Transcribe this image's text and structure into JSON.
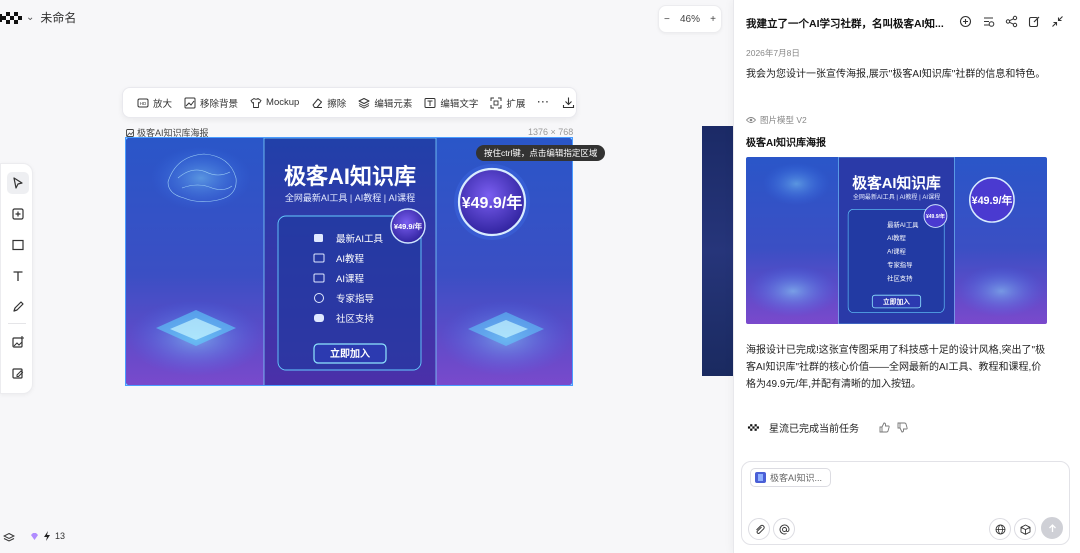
{
  "app": {
    "doc_title": "未命名"
  },
  "zoom": {
    "minus": "−",
    "value": "46%",
    "plus": "+"
  },
  "left_toolbar": {
    "tools": [
      "select-icon",
      "add-frame-icon",
      "rectangle-icon",
      "text-icon",
      "pen-icon",
      "image-add-icon",
      "image-edit-icon"
    ]
  },
  "image_toolbar": {
    "items": [
      {
        "icon": "hd-icon",
        "label": "放大"
      },
      {
        "icon": "remove-bg-icon",
        "label": "移除背景"
      },
      {
        "icon": "shirt-icon",
        "label": "Mockup"
      },
      {
        "icon": "eraser-icon",
        "label": "擦除"
      },
      {
        "icon": "layers-edit-icon",
        "label": "编辑元素"
      },
      {
        "icon": "text-edit-icon",
        "label": "编辑文字"
      },
      {
        "icon": "expand-icon",
        "label": "扩展"
      }
    ],
    "more": "···"
  },
  "canvas": {
    "label": "极客AI知识库海报",
    "size": "1376 × 768",
    "tooltip": "按住ctrl键，点击编辑指定区域"
  },
  "poster": {
    "title": "极客AI知识库",
    "subtitle": "全网最新AI工具 | AI教程 | AI课程",
    "price": "¥49.9/年",
    "badge": "¥49.9/年",
    "features": [
      "最新AI工具",
      "AI教程",
      "AI课程",
      "专家指导",
      "社区支持"
    ],
    "cta": "立即加入",
    "colors": {
      "bg_top": "#2a3fa8",
      "bg_bottom": "#6c46c6",
      "accent": "#27c7ff"
    }
  },
  "bottom_left": {
    "credits": "13"
  },
  "chat": {
    "title": "我建立了一个AI学习社群，名叫极客AI知...",
    "date": "2026年7月8日",
    "message1": "我会为您设计一张宣传海报,展示\"极客AI知识库\"社群的信息和特色。",
    "model": "图片模型 V2",
    "result_title": "极客AI知识库海报",
    "message2": "海报设计已完成!这张宣传图采用了科技感十足的设计风格,突出了\"极客AI知识库\"社群的核心价值——全网最新的AI工具、教程和课程,价格为49.9元/年,并配有清晰的加入按钮。",
    "status": "星流已完成当前任务",
    "input_chip": "极客AI知识..."
  }
}
